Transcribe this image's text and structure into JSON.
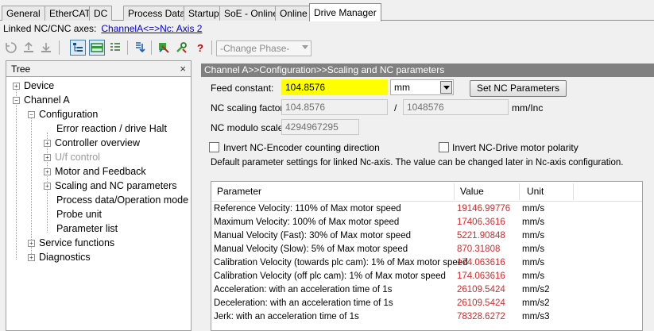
{
  "tabs": [
    {
      "label": "General",
      "active": false
    },
    {
      "label": "EtherCAT",
      "active": false
    },
    {
      "label": "DC",
      "active": false
    },
    {
      "label": "Process Data",
      "active": false
    },
    {
      "label": "Startup",
      "active": false
    },
    {
      "label": "SoE - Online",
      "active": false
    },
    {
      "label": "Online",
      "active": false
    },
    {
      "label": "Drive Manager",
      "active": true
    }
  ],
  "linked": {
    "label": "Linked NC/CNC axes:",
    "link_text": "ChannelA<=>Nc: Axis 2"
  },
  "toolbar": {
    "icons": [
      "refresh-icon",
      "upload-icon",
      "download-icon",
      "tree-view-icon",
      "layout-view-icon",
      "list-view-icon",
      "import-icon",
      "wizard-icon",
      "tools-icon",
      "help-icon"
    ],
    "phase_combo": "-Change Phase-"
  },
  "tree": {
    "title": "Tree",
    "close_glyph": "×",
    "items": [
      {
        "label": "Device",
        "expander": "+",
        "disabled": false
      },
      {
        "label": "Channel A",
        "expander": "−",
        "disabled": false
      },
      {
        "label": "Configuration",
        "expander": "−",
        "disabled": false
      },
      {
        "label": "Error reaction / drive Halt",
        "expander": "",
        "disabled": false
      },
      {
        "label": "Controller overview",
        "expander": "+",
        "disabled": false
      },
      {
        "label": "U/f control",
        "expander": "+",
        "disabled": true
      },
      {
        "label": "Motor and Feedback",
        "expander": "+",
        "disabled": false
      },
      {
        "label": "Scaling and NC parameters",
        "expander": "+",
        "disabled": false
      },
      {
        "label": "Process data/Operation mode",
        "expander": "",
        "disabled": false
      },
      {
        "label": "Probe unit",
        "expander": "",
        "disabled": false
      },
      {
        "label": "Parameter list",
        "expander": "",
        "disabled": false
      },
      {
        "label": "Service functions",
        "expander": "+",
        "disabled": false
      },
      {
        "label": "Diagnostics",
        "expander": "+",
        "disabled": false
      }
    ]
  },
  "main": {
    "breadcrumb": "Channel A>>Configuration>>Scaling and NC parameters",
    "feed_constant_label": "Feed constant:",
    "feed_constant_value": "104.8576",
    "feed_unit": "mm",
    "set_nc_button": "Set NC Parameters",
    "scaling_label": "NC scaling factor:",
    "scaling_num": "104.8576",
    "scaling_slash": "/",
    "scaling_den": "1048576",
    "scaling_unit": "mm/Inc",
    "modulo_label": "NC modulo scale:",
    "modulo_value": "4294967295",
    "invert_encoder_label": "Invert NC-Encoder counting direction",
    "invert_encoder_checked": false,
    "invert_motor_label": "Invert NC-Drive motor polarity",
    "invert_motor_checked": false,
    "info_text": "Default parameter settings for linked Nc-axis. The value can be changed later in Nc-axis configuration.",
    "value_color": "#d42a2a",
    "table": {
      "headers": [
        "Parameter",
        "Value",
        "Unit"
      ],
      "rows": [
        {
          "param": "Reference Velocity: 110% of Max motor speed",
          "value": "19146.99776",
          "unit": "mm/s"
        },
        {
          "param": "Maximum Velocity: 100% of Max motor speed",
          "value": "17406.3616",
          "unit": "mm/s"
        },
        {
          "param": "Manual Velocity (Fast): 30% of Max motor speed",
          "value": "5221.90848",
          "unit": "mm/s"
        },
        {
          "param": "Manual Velocity (Slow): 5% of Max motor speed",
          "value": "870.31808",
          "unit": "mm/s"
        },
        {
          "param": "Calibration Velocity (towards plc cam): 1% of Max motor speed",
          "value": "174.063616",
          "unit": "mm/s"
        },
        {
          "param": "Calibration Velocity (off plc cam): 1% of Max motor speed",
          "value": "174.063616",
          "unit": "mm/s"
        },
        {
          "param": "Acceleration: with an acceleration time of 1s",
          "value": "26109.5424",
          "unit": "mm/s2"
        },
        {
          "param": "Deceleration: with an acceleration time of 1s",
          "value": "26109.5424",
          "unit": "mm/s2"
        },
        {
          "param": "Jerk: with an acceleration time of 1s",
          "value": "78328.6272",
          "unit": "mm/s3"
        }
      ]
    }
  }
}
